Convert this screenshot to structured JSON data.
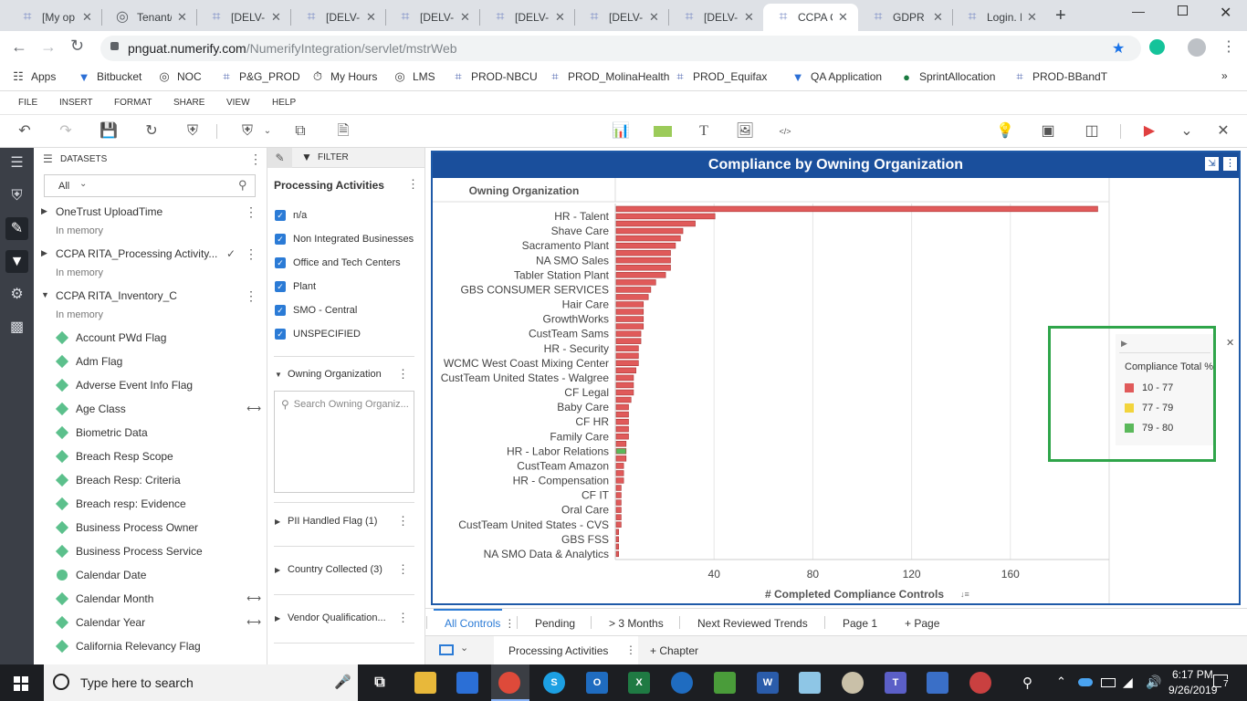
{
  "browser": {
    "tabs": [
      {
        "label": "[My op"
      },
      {
        "label": "Tenant/"
      },
      {
        "label": "[DELV-"
      },
      {
        "label": "[DELV-"
      },
      {
        "label": "[DELV-"
      },
      {
        "label": "[DELV-"
      },
      {
        "label": "[DELV-"
      },
      {
        "label": "[DELV-"
      },
      {
        "label": "CCPA C"
      },
      {
        "label": "GDPR C"
      },
      {
        "label": "Login. I"
      }
    ],
    "new_tab": "+",
    "url_host": "pnguat.numerify.com",
    "url_path": "/NumerifyIntegration/servlet/mstrWeb",
    "bookmarks": [
      "Apps",
      "Bitbucket",
      "NOC",
      "P&G_PROD",
      "My Hours",
      "LMS",
      "PROD-NBCU",
      "PROD_MolinaHealth",
      "PROD_Equifax",
      "QA Application",
      "SprintAllocation",
      "PROD-BBandT"
    ]
  },
  "menu": [
    "FILE",
    "INSERT",
    "FORMAT",
    "SHARE",
    "VIEW",
    "HELP"
  ],
  "datasets": {
    "title": "DATASETS",
    "filter_value": "All",
    "items": [
      {
        "name": "OneTrust UploadTime",
        "sub": "In memory"
      },
      {
        "name": "CCPA RITA_Processing Activity...",
        "sub": "In memory"
      },
      {
        "name": "CCPA RITA_Inventory_C",
        "sub": "In memory"
      }
    ],
    "attributes": [
      "Account PWd Flag",
      "Adm Flag",
      "Adverse Event Info Flag",
      "Age Class",
      "Biometric Data",
      "Breach Resp Scope",
      "Breach Resp: Criteria",
      "Breach resp: Evidence",
      "Business Process Owner",
      "Business Process Service",
      "Calendar Date",
      "Calendar Month",
      "Calendar Year",
      "California Relevancy Flag"
    ]
  },
  "filter": {
    "tab_label": "FILTER",
    "section_title": "Processing Activities",
    "checks": [
      "n/a",
      "Non Integrated Businesses",
      "Office and Tech Centers",
      "Plant",
      "SMO - Central",
      "UNSPECIFIED"
    ],
    "owning_org_label": "Owning Organization",
    "search_placeholder": "Search Owning Organiz...",
    "sections": [
      "PII Handled Flag (1)",
      "Country Collected (3)",
      "Vendor Qualification..."
    ]
  },
  "viz": {
    "title": "Compliance by Owning Organization",
    "header_label": "Owning Organization",
    "legend_title": "Compliance Total %",
    "legend_items": [
      {
        "label": "10 - 77",
        "color": "#e05a5a"
      },
      {
        "label": "77 - 79",
        "color": "#f2d43c"
      },
      {
        "label": "79 - 80",
        "color": "#5ab85a"
      }
    ]
  },
  "chart_data": {
    "type": "bar",
    "orientation": "horizontal",
    "xlabel": "# Completed Compliance Controls",
    "ylabel": "Owning Organization",
    "xticks": [
      40,
      80,
      120,
      160
    ],
    "xlim": [
      0,
      200
    ],
    "categories": [
      "",
      "HR - Talent",
      "",
      "Shave Care",
      "",
      "Sacramento Plant",
      "",
      "NA SMO Sales",
      "",
      "Tabler Station Plant",
      "",
      "GBS CONSUMER SERVICES",
      "",
      "Hair Care",
      "",
      "GrowthWorks",
      "",
      "CustTeam Sams",
      "",
      "HR - Security",
      "",
      "WCMC West Coast Mixing Center",
      "",
      "CustTeam United States - Walgree",
      "",
      "CF Legal",
      "",
      "Baby Care",
      "",
      "CF HR",
      "",
      "Family Care",
      "",
      "HR - Labor Relations",
      "",
      "CustTeam Amazon",
      "",
      "HR - Compensation",
      "",
      "CF IT",
      "",
      "Oral Care",
      "",
      "CustTeam United States - CVS",
      "",
      "GBS FSS",
      "",
      "NA SMO Data & Analytics"
    ],
    "values": [
      195,
      40,
      32,
      27,
      26,
      24,
      22,
      22,
      22,
      20,
      16,
      14,
      13,
      11,
      11,
      11,
      11,
      10,
      10,
      9,
      9,
      9,
      8,
      7,
      7,
      7,
      6,
      5,
      5,
      5,
      5,
      5,
      4,
      4,
      4,
      3,
      3,
      3,
      2,
      2,
      2,
      2,
      2,
      2,
      1,
      1,
      1,
      1
    ],
    "colors": [
      "r",
      "r",
      "r",
      "r",
      "r",
      "r",
      "r",
      "r",
      "r",
      "r",
      "r",
      "r",
      "r",
      "r",
      "r",
      "r",
      "r",
      "r",
      "r",
      "r",
      "r",
      "r",
      "r",
      "r",
      "r",
      "r",
      "r",
      "r",
      "r",
      "r",
      "r",
      "r",
      "r",
      "g",
      "r",
      "r",
      "r",
      "r",
      "r",
      "r",
      "r",
      "r",
      "r",
      "r",
      "r",
      "r",
      "r",
      "r"
    ]
  },
  "pages": {
    "tabs": [
      "All Controls",
      "Pending",
      "> 3 Months",
      "Next Reviewed Trends",
      "Page 1"
    ],
    "add_page": "Page",
    "chapter": "Processing Activities",
    "add_chapter": "Chapter"
  },
  "taskbar": {
    "search_placeholder": "Type here to search",
    "time": "6:17 PM",
    "date": "9/26/2019",
    "notif_count": "7"
  }
}
